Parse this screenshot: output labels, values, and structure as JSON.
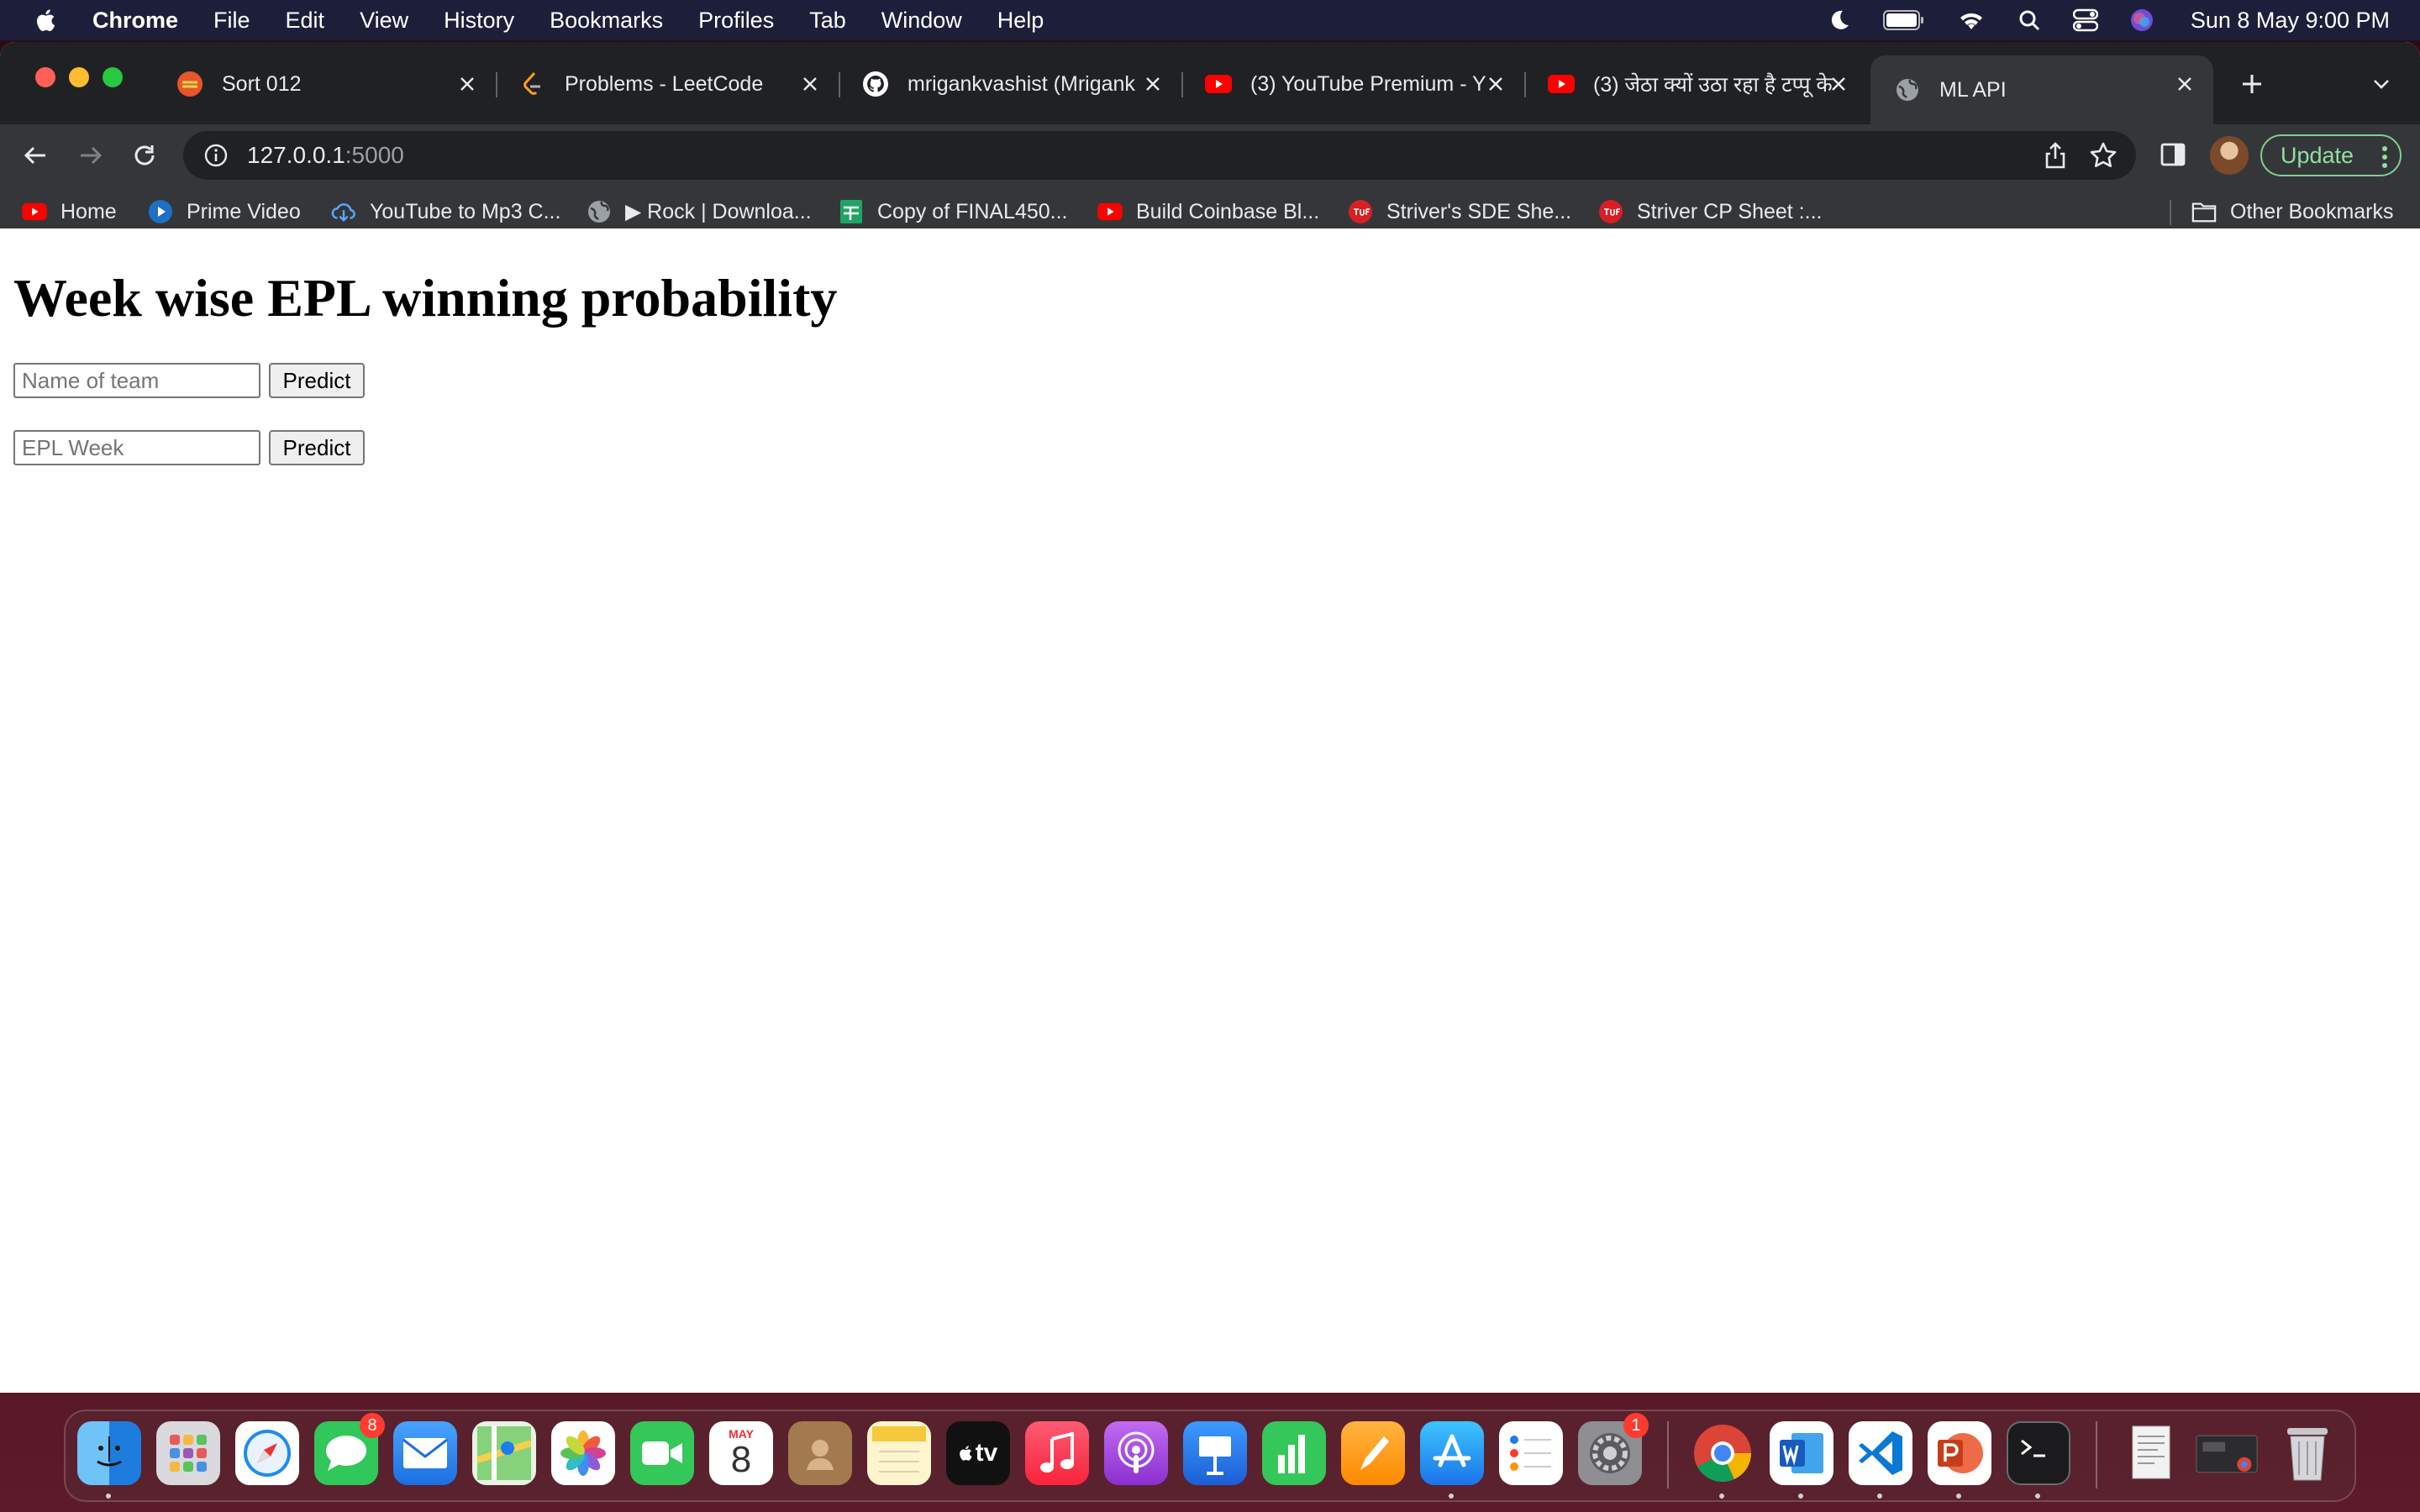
{
  "menubar": {
    "app": "Chrome",
    "items": [
      "File",
      "Edit",
      "View",
      "History",
      "Bookmarks",
      "Profiles",
      "Tab",
      "Window",
      "Help"
    ],
    "clock": "Sun 8 May  9:00 PM"
  },
  "tabs": [
    {
      "title": "Sort 012",
      "icon": "gfg-icon",
      "active": false
    },
    {
      "title": "Problems - LeetCode",
      "icon": "leetcode-icon",
      "active": false
    },
    {
      "title": "mrigankvashist (Mrigank",
      "icon": "github-icon",
      "active": false
    },
    {
      "title": "(3) YouTube Premium - Y",
      "icon": "youtube-icon",
      "active": false
    },
    {
      "title": "(3) जेठा क्यों उठा रहा है टप्पू के",
      "icon": "youtube-icon",
      "active": false
    },
    {
      "title": "ML API",
      "icon": "globe-icon",
      "active": true
    }
  ],
  "omnibox": {
    "host": "127.0.0.1",
    "port": ":5000"
  },
  "toolbar": {
    "update_label": "Update"
  },
  "bookmarks": [
    {
      "label": "Home",
      "icon": "youtube-icon"
    },
    {
      "label": "Prime Video",
      "icon": "prime-video-icon"
    },
    {
      "label": "YouTube to Mp3 C...",
      "icon": "cloud-download-icon"
    },
    {
      "label": "▶ Rock | Downloa...",
      "icon": "globe-icon"
    },
    {
      "label": "Copy of FINAL450...",
      "icon": "google-sheets-icon"
    },
    {
      "label": "Build Coinbase Bl...",
      "icon": "youtube-icon"
    },
    {
      "label": "Striver's SDE She...",
      "icon": "tuf-icon"
    },
    {
      "label": "Striver CP Sheet :...",
      "icon": "tuf-icon"
    }
  ],
  "other_bookmarks": "Other Bookmarks",
  "page": {
    "heading": "Week wise EPL winning probability",
    "team_placeholder": "Name of team",
    "team_button": "Predict",
    "week_placeholder": "EPL Week",
    "week_button": "Predict"
  },
  "dock": {
    "apps": [
      "Finder",
      "Launchpad",
      "Safari",
      "Messages",
      "Mail",
      "Maps",
      "Photos",
      "FaceTime",
      "Calendar",
      "Contacts",
      "Notes",
      "TV",
      "Music",
      "Podcasts",
      "Keynote",
      "Numbers",
      "Pages",
      "App Store",
      "Reminders",
      "System Preferences",
      "Chrome",
      "Word",
      "VS Code",
      "PowerPoint",
      "Terminal"
    ],
    "messages_badge": "8",
    "settings_badge": "1",
    "calendar_month": "MAY",
    "calendar_day": "8",
    "tv_label": "tv"
  },
  "colors": {
    "menubar": "#1d1f3a",
    "tabstrip": "#202124",
    "toolbar": "#35363a",
    "update_accent": "#8fe0a0"
  }
}
